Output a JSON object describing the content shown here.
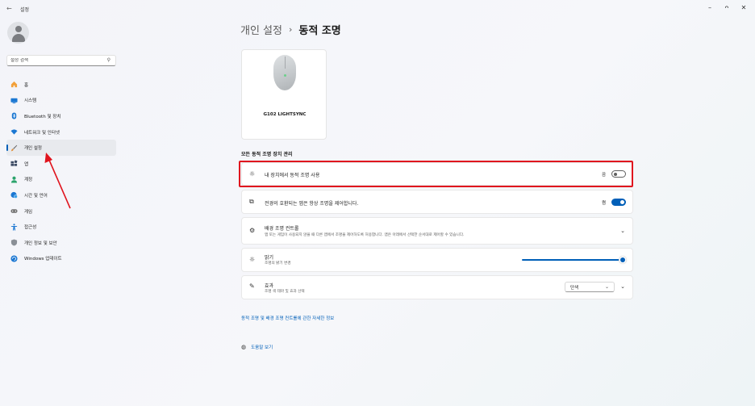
{
  "window": {
    "app_title": "설정",
    "back_glyph": "←",
    "minimize_glyph": "–",
    "maximize_glyph": "ᴖ",
    "close_glyph": "✕"
  },
  "sidebar": {
    "search_placeholder": "설정 검색",
    "items": [
      {
        "label": "홈",
        "icon": "home-icon",
        "color": "#f2a03a"
      },
      {
        "label": "시스템",
        "icon": "monitor-icon",
        "color": "#1b77d2"
      },
      {
        "label": "Bluetooth 및 장치",
        "icon": "bluetooth-icon",
        "color": "#1b77d2"
      },
      {
        "label": "네트워크 및 인터넷",
        "icon": "wifi-icon",
        "color": "#1b77d2"
      },
      {
        "label": "개인 설정",
        "icon": "brush-icon",
        "color": "#e08a30"
      },
      {
        "label": "앱",
        "icon": "apps-icon",
        "color": "#3b4a63"
      },
      {
        "label": "계정",
        "icon": "person-icon",
        "color": "#2aa36b"
      },
      {
        "label": "시간 및 언어",
        "icon": "globe-clock-icon",
        "color": "#1b77d2"
      },
      {
        "label": "게임",
        "icon": "gamepad-icon",
        "color": "#707070"
      },
      {
        "label": "접근성",
        "icon": "accessibility-icon",
        "color": "#1b77d2"
      },
      {
        "label": "개인 정보 및 보안",
        "icon": "shield-icon",
        "color": "#707070"
      },
      {
        "label": "Windows 업데이트",
        "icon": "update-icon",
        "color": "#1b77d2"
      }
    ],
    "active_index": 4
  },
  "header": {
    "parent": "개인 설정",
    "separator": "›",
    "current": "동적 조명"
  },
  "device": {
    "name": "G102 LIGHTSYNC"
  },
  "section_heading": "모든 동적 조명 장치 관리",
  "settings": {
    "use_on_device": {
      "title": "내 장치에서 동적 조명 사용",
      "state_label": "끔",
      "on": false
    },
    "compatible_apps": {
      "title": "전경의 호환되는 앱은 항상 조명을 제어합니다.",
      "state_label": "켬",
      "on": true
    },
    "background_control": {
      "title": "배경 조명 컨트롤",
      "subtitle": "앱 또는 게임이 사용되지 않을 때 다른 앱에서 조명을 제어하도록 허용합니다. 앱은 아래에서 선택한 순서대로 제어할 수 있습니다."
    },
    "brightness": {
      "title": "밝기",
      "subtitle": "조명의 밝기 변경",
      "value": 100
    },
    "effects": {
      "title": "효과",
      "subtitle": "조명 색 테마 및 효과 선택",
      "selected": "단색"
    }
  },
  "link_text": "동적 조명 및 배경 조명 컨트롤에 관한 자세한 정보",
  "help_text": "도움말 보기",
  "annotation_color": "#e0141e",
  "accent": "#005fb8"
}
